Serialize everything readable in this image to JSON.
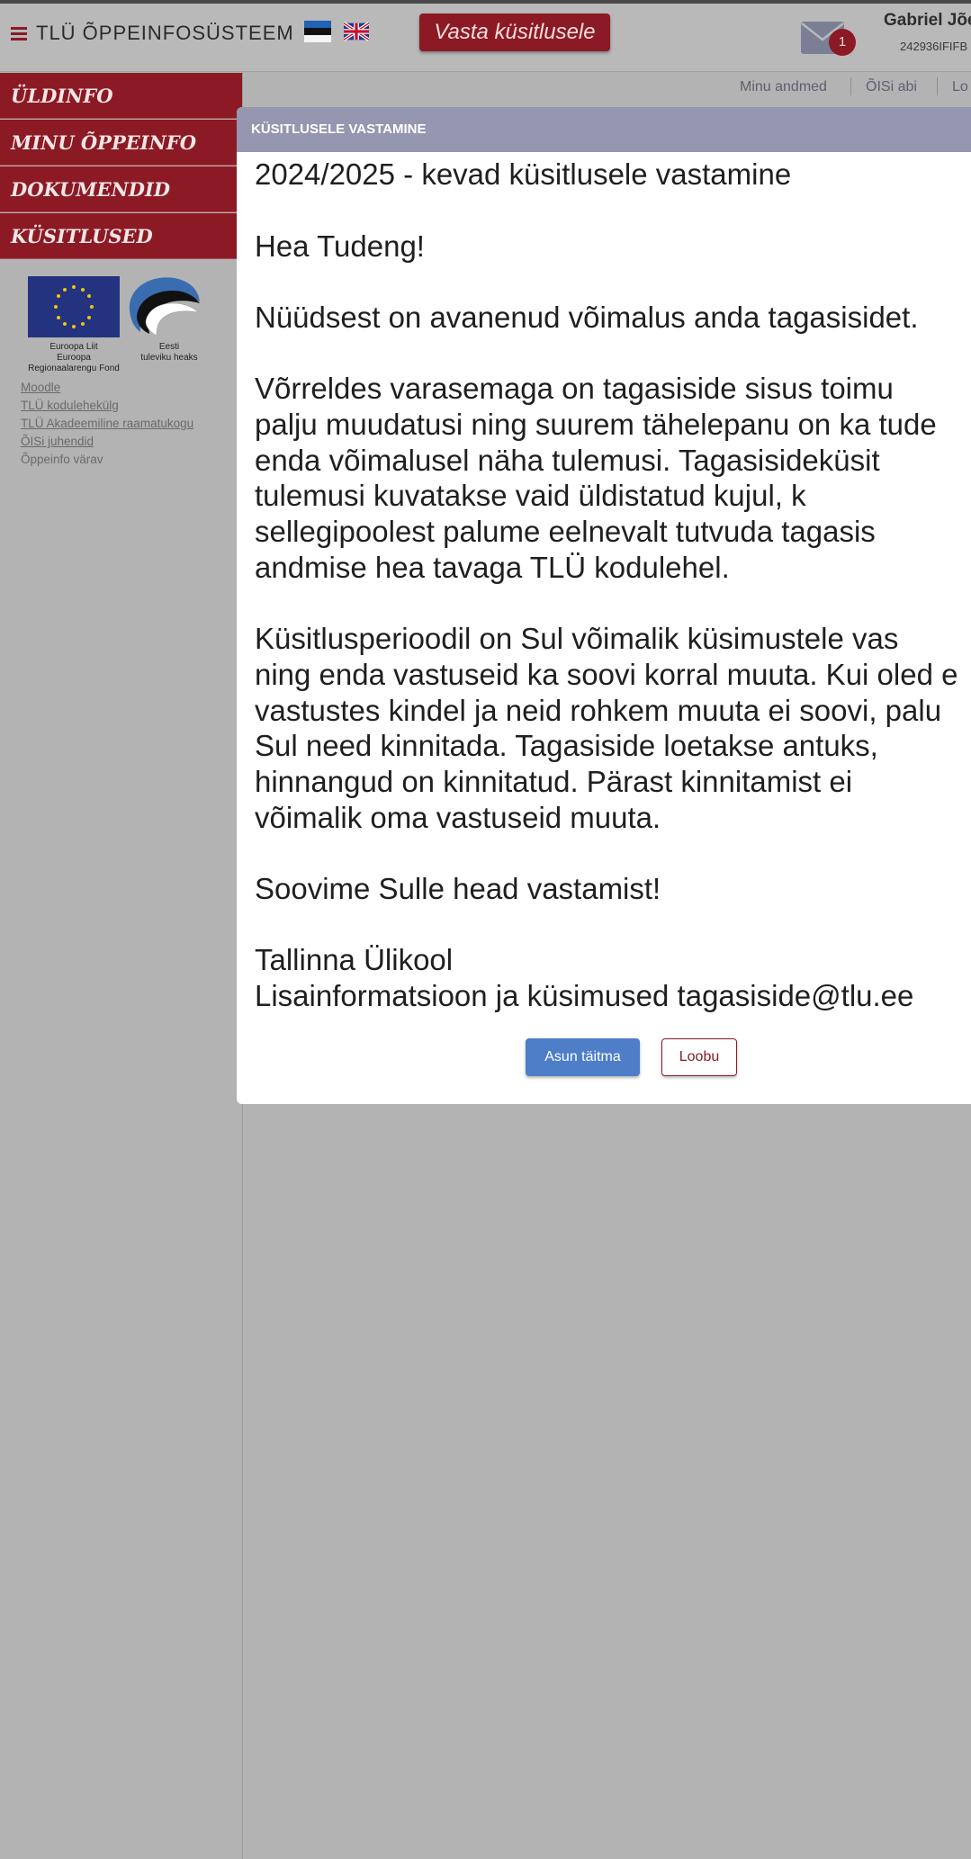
{
  "header": {
    "app_title": "TLÜ ÕPPEINFOSÜSTEEM",
    "survey_button": "Vasta küsitlusele",
    "mail_count": "1",
    "user_name": "Gabriel Jõe",
    "user_code": "242936IFIFB"
  },
  "subnav": {
    "my_data": "Minu andmed",
    "help": "ÕISi abi",
    "logout": "Lo"
  },
  "sidebar": {
    "items": [
      {
        "label": "ÜLDINFO"
      },
      {
        "label": "MINU ÕPPEINFO"
      },
      {
        "label": "DOKUMENDID"
      },
      {
        "label": "KÜSITLUSED"
      }
    ],
    "eu_caption": [
      "Euroopa Liit",
      "Euroopa",
      "Regionaalarengu Fond"
    ],
    "ee_caption": [
      "Eesti",
      "tuleviku heaks"
    ],
    "links": [
      {
        "label": "Moodle"
      },
      {
        "label": "TLÜ kodulehekülg"
      },
      {
        "label": "TLÜ Akadeemiline raamatukogu"
      },
      {
        "label": "ÕISi juhendid"
      },
      {
        "label": "Õppeinfo värav"
      }
    ]
  },
  "modal": {
    "title": "KÜSITLUSELE VASTAMINE",
    "lines": [
      "2024/2025 - kevad küsitlusele vastamine",
      "Hea Tudeng!",
      "Nüüdsest on avanenud võimalus anda tagasisidet.",
      "Võrreldes varasemaga on tagasiside sisus toimu",
      "palju muudatusi ning suurem tähelepanu on ka tude",
      "enda võimalusel näha tulemusi. Tagasisideküsit",
      "tulemusi kuvatakse vaid üldistatud kujul, k",
      "sellegipoolest palume eelnevalt tutvuda tagasis",
      "andmise hea tavaga TLÜ kodulehel.",
      "Küsitlusperioodil on Sul võimalik küsimustele vas",
      "ning enda vastuseid ka soovi korral muuta. Kui oled e",
      "vastustes kindel ja neid rohkem muuta ei soovi, palu",
      "Sul need kinnitada. Tagasiside loetakse antuks,",
      "hinnangud on kinnitatud. Pärast kinnitamist ei",
      "võimalik oma vastuseid muuta.",
      "Soovime Sulle head vastamist!",
      "Tallinna Ülikool",
      "Lisainformatsioon ja küsimused tagasiside@tlu.ee"
    ],
    "primary_button": "Asun täitma",
    "cancel_button": "Loobu"
  },
  "colors": {
    "brand_red": "#8b1a24",
    "modal_header": "#9597b0",
    "primary_blue": "#4f7ec9",
    "overlay_gray": "#b3b3b3"
  }
}
